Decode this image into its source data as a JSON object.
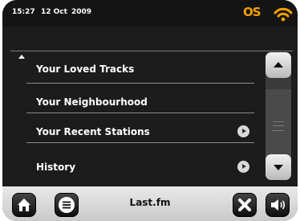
{
  "status": {
    "time": "15:27",
    "date": "12 Oct",
    "year": "2009",
    "brand_mark": "OS"
  },
  "list": {
    "items": [
      {
        "label": "Your Loved Tracks",
        "has_play": false
      },
      {
        "label": "Your Neighbourhood",
        "has_play": false
      },
      {
        "label": "Your Recent Stations",
        "has_play": true
      },
      {
        "label": "History",
        "has_play": true
      }
    ]
  },
  "bottom": {
    "title": "Last.fm"
  },
  "colors": {
    "accent": "#f5a000",
    "background": "#1c1c1c",
    "bar": "#d6d6d6"
  },
  "icons": [
    "wifi-icon",
    "home-icon",
    "menu-icon",
    "close-icon",
    "speaker-icon",
    "play-icon",
    "scroll-up-icon",
    "scroll-down-icon"
  ]
}
